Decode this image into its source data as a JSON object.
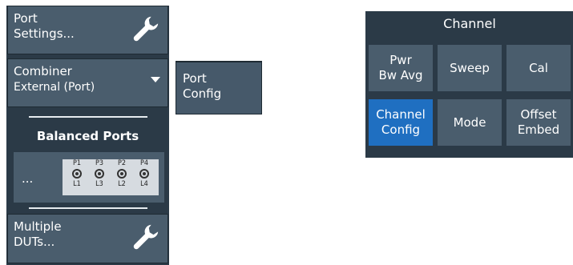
{
  "left_panel": {
    "port_settings_label": "Port\nSettings...",
    "combiner": {
      "title": "Combiner",
      "value": "External (Port)"
    },
    "balanced_ports_title": "Balanced Ports",
    "ports_ellipsis": "...",
    "ports": [
      {
        "top": "P1",
        "bottom": "L1"
      },
      {
        "top": "P3",
        "bottom": "L3"
      },
      {
        "top": "P2",
        "bottom": "L2"
      },
      {
        "top": "P4",
        "bottom": "L4"
      }
    ],
    "multiple_duts_label": "Multiple\nDUTs..."
  },
  "submenu": {
    "port_config_label": "Port\nConfig"
  },
  "channel_panel": {
    "title": "Channel",
    "buttons": [
      {
        "label": "Pwr\nBw Avg"
      },
      {
        "label": "Sweep"
      },
      {
        "label": "Cal"
      },
      {
        "label": "Channel\nConfig",
        "active": true
      },
      {
        "label": "Mode"
      },
      {
        "label": "Offset\nEmbed"
      }
    ]
  },
  "colors": {
    "panel_bg": "#2b3a47",
    "button_bg": "#4a5d6d",
    "active_bg": "#1f6fc1"
  }
}
